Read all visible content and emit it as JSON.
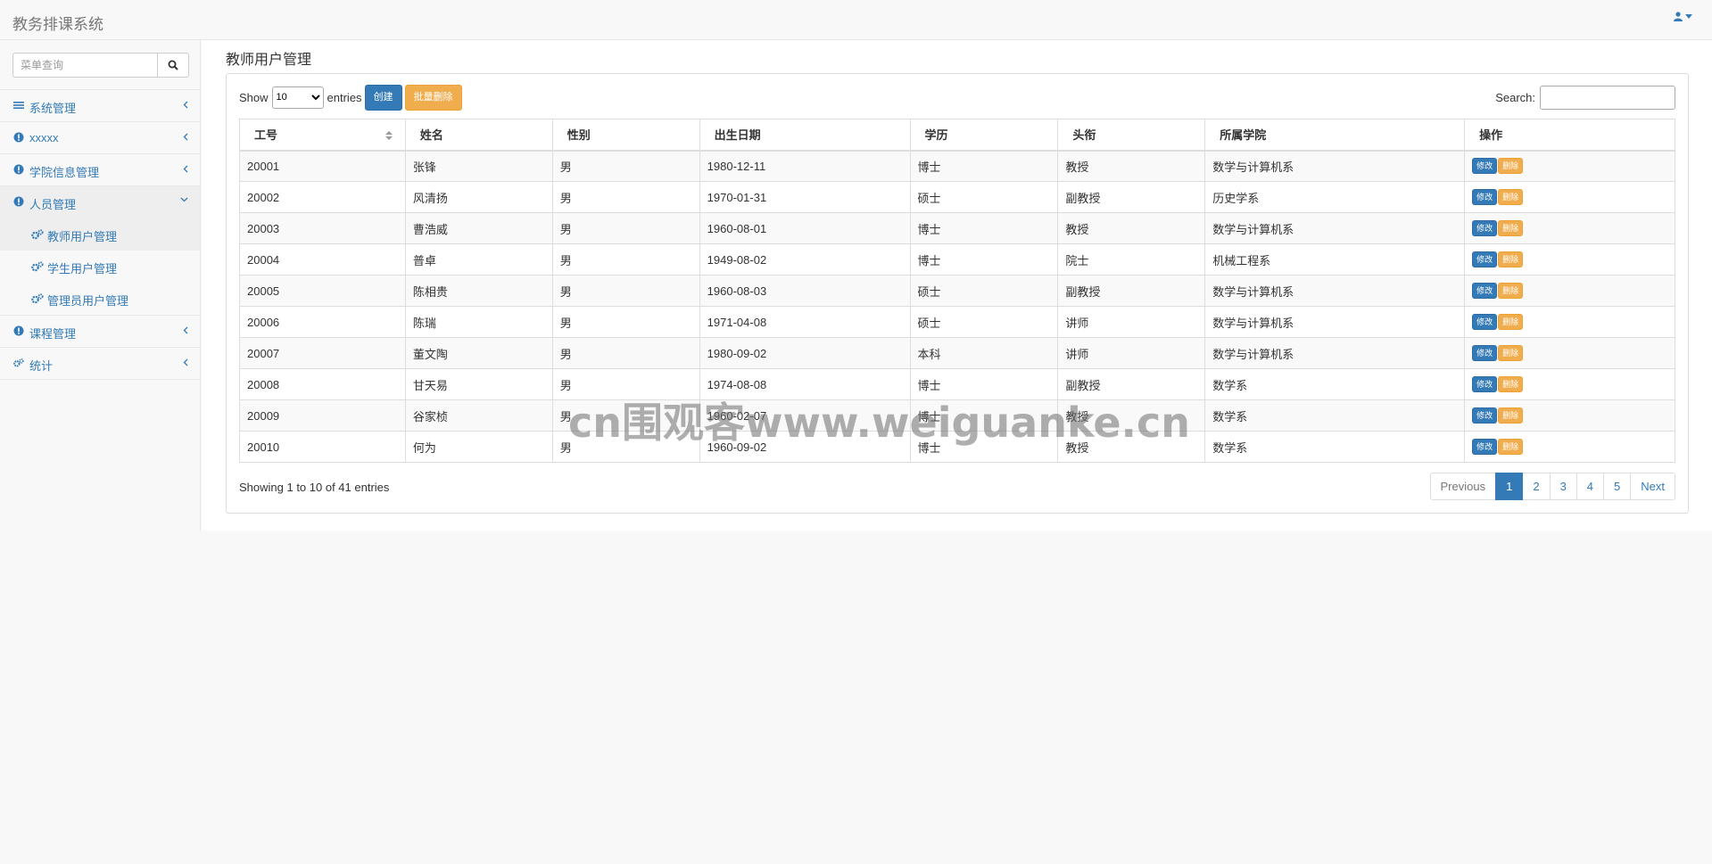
{
  "navbar": {
    "brand": "教务排课系统",
    "user_icon": "user-icon"
  },
  "sidebar": {
    "search_placeholder": "菜单查询",
    "items": [
      {
        "label": "系统管理",
        "icon": "bars-icon"
      },
      {
        "label": "xxxxx",
        "icon": "info-circle-icon"
      },
      {
        "label": "学院信息管理",
        "icon": "info-circle-icon"
      },
      {
        "label": "人员管理",
        "icon": "info-circle-icon",
        "expanded": true,
        "children": [
          {
            "label": "教师用户管理"
          },
          {
            "label": "学生用户管理"
          },
          {
            "label": "管理员用户管理"
          }
        ]
      },
      {
        "label": "课程管理",
        "icon": "info-circle-icon"
      },
      {
        "label": "统计",
        "icon": "cogs-icon"
      }
    ]
  },
  "main": {
    "title": "教师用户管理",
    "show_label": "Show",
    "entries_label": "entries",
    "page_size": "10",
    "create_label": "创建",
    "batch_delete_label": "批量删除",
    "search_label": "Search:",
    "columns": [
      "工号",
      "姓名",
      "性别",
      "出生日期",
      "学历",
      "头衔",
      "所属学院",
      "操作"
    ],
    "edit_label": "修改",
    "delete_label": "删除",
    "rows": [
      [
        "20001",
        "张锋",
        "男",
        "1980-12-11",
        "博士",
        "教授",
        "数学与计算机系"
      ],
      [
        "20002",
        "风清扬",
        "男",
        "1970-01-31",
        "硕士",
        "副教授",
        "历史学系"
      ],
      [
        "20003",
        "曹浩威",
        "男",
        "1960-08-01",
        "博士",
        "教授",
        "数学与计算机系"
      ],
      [
        "20004",
        "普卓",
        "男",
        "1949-08-02",
        "博士",
        "院士",
        "机械工程系"
      ],
      [
        "20005",
        "陈相贵",
        "男",
        "1960-08-03",
        "硕士",
        "副教授",
        "数学与计算机系"
      ],
      [
        "20006",
        "陈瑞",
        "男",
        "1971-04-08",
        "硕士",
        "讲师",
        "数学与计算机系"
      ],
      [
        "20007",
        "董文陶",
        "男",
        "1980-09-02",
        "本科",
        "讲师",
        "数学与计算机系"
      ],
      [
        "20008",
        "甘天易",
        "男",
        "1974-08-08",
        "博士",
        "副教授",
        "数学系"
      ],
      [
        "20009",
        "谷家桢",
        "男",
        "1960-02-07",
        "博士",
        "教授",
        "数学系"
      ],
      [
        "20010",
        "何为",
        "男",
        "1960-09-02",
        "博士",
        "教授",
        "数学系"
      ]
    ],
    "info": "Showing 1 to 10 of 41 entries",
    "pagination": {
      "previous": "Previous",
      "pages": [
        "1",
        "2",
        "3",
        "4",
        "5"
      ],
      "active": "1",
      "next": "Next"
    }
  },
  "watermark": "cn围观客www.weiguanke.cn",
  "colors": {
    "primary": "#337ab7",
    "warning": "#f0ad4e"
  }
}
